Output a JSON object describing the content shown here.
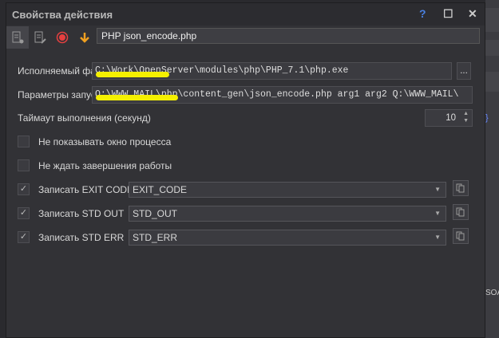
{
  "window": {
    "title": "Свойства действия",
    "help": "?",
    "maximize": "☐",
    "close": "✕"
  },
  "toolbar": {
    "action_name": "PHP json_encode.php"
  },
  "form": {
    "exe_label": "Исполняемый файл",
    "exe_value": "C:\\Work\\OpenServer\\modules\\php\\PHP_7.1\\php.exe",
    "browse": "...",
    "args_label": "Параметры запуска",
    "args_value": "Q:\\WWW_MAIL\\php\\content_gen\\json_encode.php arg1 arg2 Q:\\WWW_MAIL\\",
    "timeout_label": "Таймаут выполнения (секунд)",
    "timeout_value": "10",
    "hide_window_label": "Не показывать окно процесса",
    "hide_window_checked": false,
    "no_wait_label": "Не ждать завершения работы",
    "no_wait_checked": false,
    "outputs": [
      {
        "label": "Записать EXIT CODE",
        "value": "EXIT_CODE",
        "checked": true
      },
      {
        "label": "Записать STD OUT",
        "value": "STD_OUT",
        "checked": true
      },
      {
        "label": "Записать STD ERR",
        "value": "STD_ERR",
        "checked": true
      }
    ]
  },
  "background": {
    "brace": "}",
    "fragment": "SOA"
  },
  "colors": {
    "record": "#e84040",
    "arrow": "#f0a020",
    "highlight": "#f5f000"
  }
}
